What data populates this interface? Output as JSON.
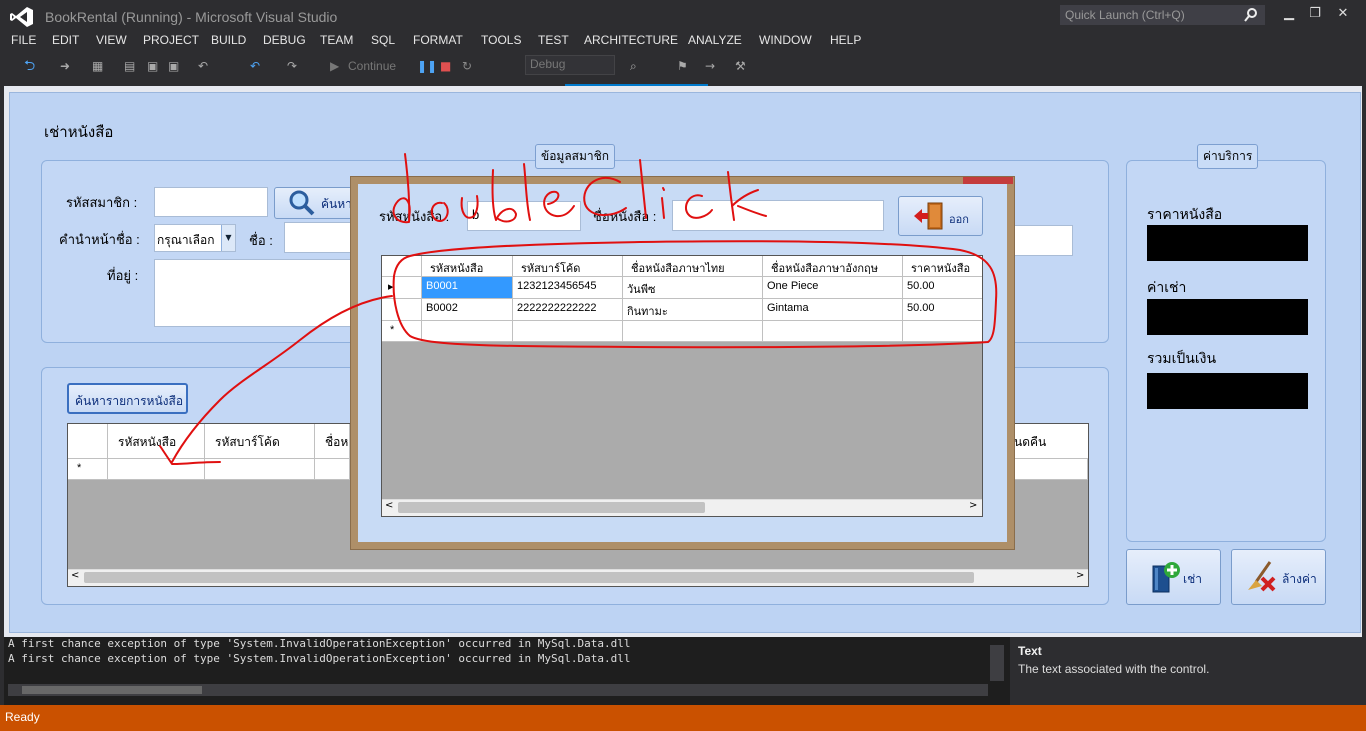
{
  "window": {
    "title": "BookRental (Running) - Microsoft Visual Studio",
    "quick_launch_placeholder": "Quick Launch (Ctrl+Q)"
  },
  "menu": [
    "FILE",
    "EDIT",
    "VIEW",
    "PROJECT",
    "BUILD",
    "DEBUG",
    "TEAM",
    "SQL",
    "FORMAT",
    "TOOLS",
    "TEST",
    "ARCHITECTURE",
    "ANALYZE",
    "WINDOW",
    "HELP"
  ],
  "toolbar": {
    "continue_label": "Continue",
    "config_value": "Debug"
  },
  "form": {
    "heading": "เช่าหนังสือ",
    "member_group": {
      "title": "ข้อมูลสมาชิก",
      "member_id_label": "รหัสสมาชิก :",
      "member_id_value": "",
      "search_button": "ค้นหา",
      "prefix_label": "คำนำหน้าชื่อ :",
      "prefix_value": "กรุณาเลือก",
      "name_label": "ชื่อ :",
      "address_label": "ที่อยู่ :"
    },
    "book_group": {
      "search_button": "ค้นหารายการหนังสือ",
      "columns": [
        "รหัสหนังสือ",
        "รหัสบาร์โค้ด",
        "ชื่อห",
        "นดคืน"
      ],
      "new_row_marker": "*"
    },
    "fee_group": {
      "title": "ค่าบริการ",
      "book_price_label": "ราคาหนังสือ",
      "rent_label": "ค่าเช่า",
      "total_label": "รวมเป็นเงิน"
    },
    "rent_button": "เช่า",
    "clear_button": "ล้างค่า"
  },
  "popup": {
    "book_id_label": "รหัสหนังสือ :",
    "book_id_value": "b",
    "book_name_label": "ชื่อหนังสือ :",
    "book_name_value": "",
    "exit_button": "ออก",
    "columns": [
      "รหัสหนังสือ",
      "รหัสบาร์โค้ด",
      "ชื่อหนังสือภาษาไทย",
      "ชื่อหนังสือภาษาอังกฤษ",
      "ราคาหนังสือ"
    ],
    "rows": [
      [
        "B0001",
        "1232123456545",
        "วันพีซ",
        "One Piece",
        "50.00"
      ],
      [
        "B0002",
        "2222222222222",
        "กินทามะ",
        "Gintama",
        "50.00"
      ]
    ],
    "current_row_marker": "▸",
    "new_row_marker": "*"
  },
  "annotation": {
    "text": "doubleClick",
    "color": "#e01010"
  },
  "output": {
    "lines": [
      "A first chance exception of type 'System.InvalidOperationException' occurred in MySql.Data.dll",
      "A first chance exception of type 'System.InvalidOperationException' occurred in MySql.Data.dll"
    ]
  },
  "properties": {
    "name": "Text",
    "description": "The text associated with the control."
  },
  "status": "Ready",
  "colors": {
    "status_bar": "#ca5100",
    "vs_chrome": "#2d2d30",
    "form_bg": "#c5d8f2",
    "selection": "#3399ff"
  }
}
